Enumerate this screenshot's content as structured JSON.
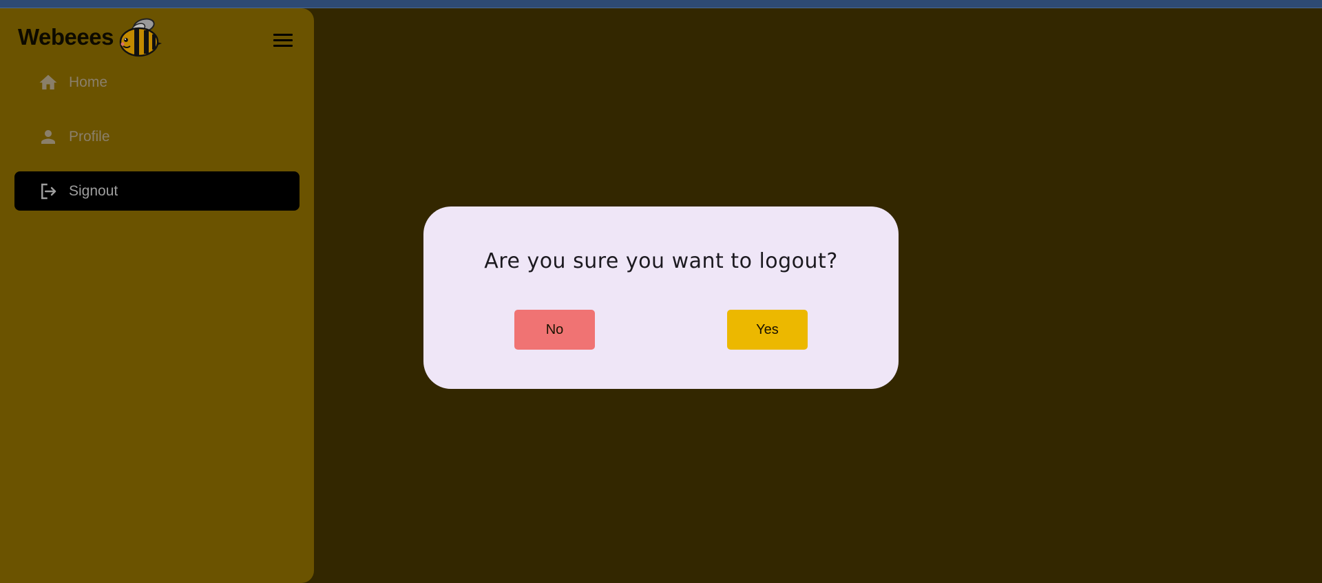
{
  "app": {
    "brand_name": "Webeees",
    "logo_icon": "bee-icon",
    "menu_icon": "hamburger-menu-icon"
  },
  "sidebar": {
    "items": [
      {
        "label": "Home",
        "icon": "home-icon",
        "active": false
      },
      {
        "label": "Profile",
        "icon": "person-icon",
        "active": false
      },
      {
        "label": "Signout",
        "icon": "logout-icon",
        "active": true
      }
    ]
  },
  "dialog": {
    "title": "Are you sure you want to logout?",
    "no_label": "No",
    "yes_label": "Yes"
  },
  "colors": {
    "topbar": "#2e4a73",
    "sidebar_bg": "#6b5300",
    "overlay_bg": "#332700",
    "dialog_bg": "#efe6f7",
    "no_button": "#f07373",
    "yes_button": "#ecb800",
    "active_item_bg": "#000000"
  }
}
